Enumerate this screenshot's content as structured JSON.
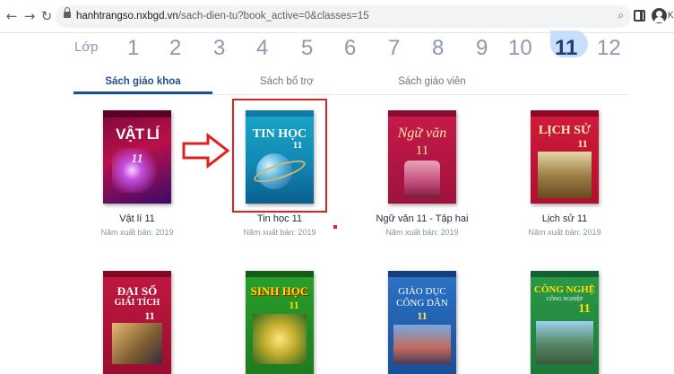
{
  "browser": {
    "url_host": "hanhtrangso.nxbgd.vn",
    "url_path": "/sach-dien-tu?book_active=0&classes=15",
    "profile_text": "Kh"
  },
  "grades": {
    "label": "Lớp",
    "items": [
      "1",
      "2",
      "3",
      "4",
      "5",
      "6",
      "7",
      "8",
      "9",
      "10",
      "11",
      "12"
    ],
    "active": "11"
  },
  "tabs": [
    {
      "label": "Sách giáo khoa",
      "active": true
    },
    {
      "label": "Sách bổ trợ",
      "active": false
    },
    {
      "label": "Sách giáo viên",
      "active": false
    }
  ],
  "books": [
    {
      "title": "Vật lí 11",
      "year": "Năm xuất bản: 2019",
      "cover_text": "VẬT LÍ",
      "cover_num": "11"
    },
    {
      "title": "Tin học 11",
      "year": "Năm xuất bản: 2019",
      "cover_text": "TIN HỌC",
      "cover_num": "11"
    },
    {
      "title": "Ngữ văn 11 - Tập hai",
      "year": "Năm xuất bản: 2019",
      "cover_text": "Ngữ văn",
      "cover_num": "11"
    },
    {
      "title": "Lịch sử 11",
      "year": "Năm xuất bản: 2019",
      "cover_text": "LỊCH SỬ",
      "cover_num": "11"
    },
    {
      "cover_text": "ĐẠI SỐ",
      "cover_text2": "GIẢI TÍCH",
      "cover_num": "11"
    },
    {
      "cover_text": "SINH HỌC",
      "cover_num": "11"
    },
    {
      "cover_text": "GIÁO DỤC",
      "cover_text2": "CÔNG DÂN",
      "cover_num": "11"
    },
    {
      "cover_text": "CÔNG NGHỆ",
      "cover_text2": "CÔNG NGHIỆP",
      "cover_num": "11"
    }
  ],
  "colors": {
    "annotation": "#e02020",
    "active_tab": "#1d4f91",
    "active_grade_bg": "#c8defb"
  }
}
